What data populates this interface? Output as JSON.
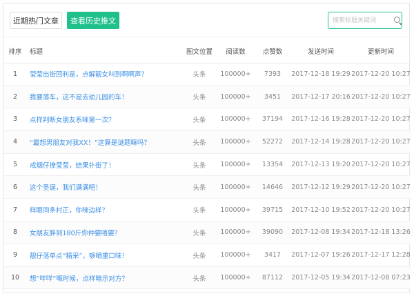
{
  "toolbar": {
    "hot_label": "近期热门文章",
    "history_label": "查看历史推文",
    "search_placeholder": "搜索标题关键词"
  },
  "table": {
    "headers": {
      "rank": "排序",
      "title": "标题",
      "position": "图文位置",
      "reads": "阅读数",
      "likes": "点赞数",
      "sent": "发送时间",
      "updated": "更新时间"
    },
    "rows": [
      {
        "rank": "1",
        "title": "莹莹出街回利是，点解靓女叫到啊啊声？",
        "position": "头条",
        "reads": "100000+",
        "likes": "7393",
        "sent": "2017-12-18 19:29",
        "updated": "2017-12-20 10:27"
      },
      {
        "rank": "2",
        "title": "我要落车，这不是去幼儿园的车！",
        "position": "头条",
        "reads": "100000+",
        "likes": "3451",
        "sent": "2017-12-17 20:16",
        "updated": "2017-12-20 10:27"
      },
      {
        "rank": "3",
        "title": "点样判断女朋友系咪第一次？",
        "position": "头条",
        "reads": "100000+",
        "likes": "37194",
        "sent": "2017-12-16 19:28",
        "updated": "2017-12-20 10:27"
      },
      {
        "rank": "4",
        "title": "“最想男朋友对我XX！”这算是谜题嘛吗？",
        "position": "头条",
        "reads": "100000+",
        "likes": "52272",
        "sent": "2017-12-14 19:28",
        "updated": "2017-12-20 10:27"
      },
      {
        "rank": "5",
        "title": "戒烟仔撩莹莹，结果扑街了！",
        "position": "头条",
        "reads": "100000+",
        "likes": "13354",
        "sent": "2017-12-13 19:20",
        "updated": "2017-12-20 10:27"
      },
      {
        "rank": "6",
        "title": "这个圣诞，我们满满吧！",
        "position": "头条",
        "reads": "100000+",
        "likes": "14646",
        "sent": "2017-12-12 19:29",
        "updated": "2017-12-20 10:27"
      },
      {
        "rank": "7",
        "title": "样眼同条村正，你咪边样？",
        "position": "头条",
        "reads": "100000+",
        "likes": "39715",
        "sent": "2017-12-10 19:52",
        "updated": "2017-12-20 10:27"
      },
      {
        "rank": "8",
        "title": "女朋友胖到180斤你仲要唔要？",
        "position": "头条",
        "reads": "100000+",
        "likes": "39090",
        "sent": "2017-12-08 19:34",
        "updated": "2017-12-18 13:26"
      },
      {
        "rank": "9",
        "title": "靓仔落单点“精采”，够晒重口味！",
        "position": "头条",
        "reads": "100000+",
        "likes": "3417",
        "sent": "2017-12-07 19:26",
        "updated": "2017-12-17 12:28"
      },
      {
        "rank": "10",
        "title": "想“咩咩”嘅时候，点样暗示对方？",
        "position": "头条",
        "reads": "100000+",
        "likes": "87112",
        "sent": "2017-12-05 19:34",
        "updated": "2017-12-08 07:23"
      }
    ]
  }
}
